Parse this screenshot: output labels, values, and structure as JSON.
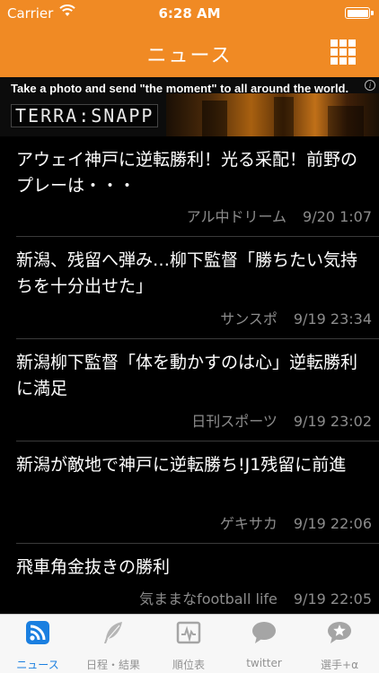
{
  "status_bar": {
    "carrier": "Carrier",
    "time": "6:28 AM"
  },
  "nav": {
    "title": "ニュース",
    "menu_icon": "grid-icon"
  },
  "ad": {
    "tagline": "Take a photo and send  \"the moment\" to all around the world.",
    "brand": "TERRA:SNAPP",
    "info_glyph": "i"
  },
  "news": [
    {
      "headline": "アウェイ神戸に逆転勝利！光る采配！前野のプレーは・・・",
      "source": "アル中ドリーム",
      "date": "9/20 1:07"
    },
    {
      "headline": "新潟、残留へ弾み…柳下監督「勝ちたい気持ちを十分出せた」",
      "source": "サンスポ",
      "date": "9/19 23:34"
    },
    {
      "headline": "新潟柳下監督「体を動かすのは心」逆転勝利に満足",
      "source": "日刊スポーツ",
      "date": "9/19 23:02"
    },
    {
      "headline": "新潟が敵地で神戸に逆転勝ち!J1残留に前進",
      "source": "ゲキサカ",
      "date": "9/19 22:06"
    },
    {
      "headline": "飛車角金抜きの勝利",
      "source": "気ままなfootball life",
      "date": "9/19 22:05"
    }
  ],
  "tabs": [
    {
      "label": "ニュース",
      "icon": "rss-icon",
      "active": true
    },
    {
      "label": "日程・結果",
      "icon": "feather-icon",
      "active": false
    },
    {
      "label": "順位表",
      "icon": "chart-icon",
      "active": false
    },
    {
      "label": "twitter",
      "icon": "speech-bubble-icon",
      "active": false
    },
    {
      "label": "選手+α",
      "icon": "star-bubble-icon",
      "active": false
    }
  ],
  "colors": {
    "accent": "#f08a24",
    "tab_active": "#1a7fe0",
    "tab_inactive": "#929292",
    "meta_text": "#8c8c8c"
  }
}
